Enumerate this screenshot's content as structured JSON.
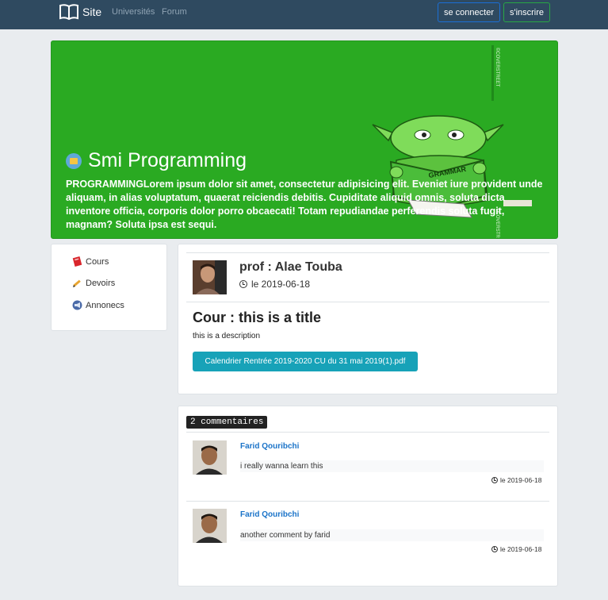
{
  "nav": {
    "brand": "Site",
    "links": [
      "Universités",
      "Forum"
    ],
    "login": "se connecter",
    "signup": "s'inscrire"
  },
  "hero": {
    "title": "Smi Programming",
    "description": "PROGRAMMINGLorem ipsum dolor sit amet, consectetur adipisicing elit. Eveniet iure provident unde aliquam, in alias voluptatum, quaerat reiciendis debitis. Cupiditate aliquid omnis, soluta dicta inventore officia, corporis dolor porro obcaecati! Totam repudiandae perferendis soluta fugit, magnam? Soluta ipsa est sequi.",
    "art_text": "GRAMMAR",
    "watermark": "©COVERSTREET",
    "accent": "#2aaa22"
  },
  "sidebar": {
    "items": [
      {
        "label": "Cours",
        "icon": "red-book-icon"
      },
      {
        "label": "Devoirs",
        "icon": "pencil-icon"
      },
      {
        "label": "Annonecs",
        "icon": "megaphone-icon"
      }
    ]
  },
  "post": {
    "author": "prof : Alae Touba",
    "date": "le 2019-06-18",
    "title": "Cour : this is a title",
    "description": "this is a description",
    "file": "Calendrier Rentrée 2019-2020 CU du 31 mai 2019(1).pdf"
  },
  "comments": {
    "count_label": "2 commentaires",
    "items": [
      {
        "author": "Farid Qouribchi",
        "text": "i really wanna learn this",
        "date": "le 2019-06-18"
      },
      {
        "author": "Farid Qouribchi",
        "text": "another comment by farid",
        "date": "le 2019-06-18"
      }
    ]
  }
}
